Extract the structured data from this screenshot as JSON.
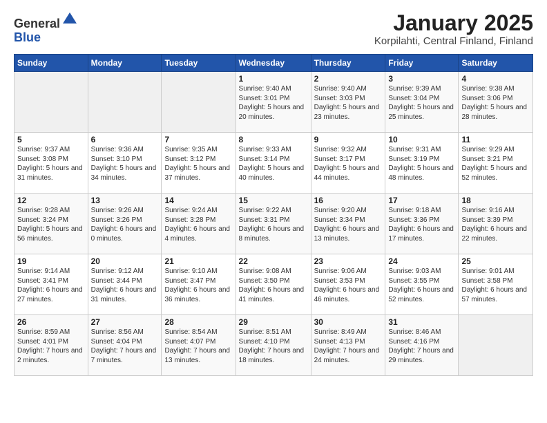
{
  "header": {
    "logo_line1": "General",
    "logo_line2": "Blue",
    "title": "January 2025",
    "subtitle": "Korpilahti, Central Finland, Finland"
  },
  "weekdays": [
    "Sunday",
    "Monday",
    "Tuesday",
    "Wednesday",
    "Thursday",
    "Friday",
    "Saturday"
  ],
  "weeks": [
    [
      {
        "day": "",
        "info": ""
      },
      {
        "day": "",
        "info": ""
      },
      {
        "day": "",
        "info": ""
      },
      {
        "day": "1",
        "info": "Sunrise: 9:40 AM\nSunset: 3:01 PM\nDaylight: 5 hours\nand 20 minutes."
      },
      {
        "day": "2",
        "info": "Sunrise: 9:40 AM\nSunset: 3:03 PM\nDaylight: 5 hours\nand 23 minutes."
      },
      {
        "day": "3",
        "info": "Sunrise: 9:39 AM\nSunset: 3:04 PM\nDaylight: 5 hours\nand 25 minutes."
      },
      {
        "day": "4",
        "info": "Sunrise: 9:38 AM\nSunset: 3:06 PM\nDaylight: 5 hours\nand 28 minutes."
      }
    ],
    [
      {
        "day": "5",
        "info": "Sunrise: 9:37 AM\nSunset: 3:08 PM\nDaylight: 5 hours\nand 31 minutes."
      },
      {
        "day": "6",
        "info": "Sunrise: 9:36 AM\nSunset: 3:10 PM\nDaylight: 5 hours\nand 34 minutes."
      },
      {
        "day": "7",
        "info": "Sunrise: 9:35 AM\nSunset: 3:12 PM\nDaylight: 5 hours\nand 37 minutes."
      },
      {
        "day": "8",
        "info": "Sunrise: 9:33 AM\nSunset: 3:14 PM\nDaylight: 5 hours\nand 40 minutes."
      },
      {
        "day": "9",
        "info": "Sunrise: 9:32 AM\nSunset: 3:17 PM\nDaylight: 5 hours\nand 44 minutes."
      },
      {
        "day": "10",
        "info": "Sunrise: 9:31 AM\nSunset: 3:19 PM\nDaylight: 5 hours\nand 48 minutes."
      },
      {
        "day": "11",
        "info": "Sunrise: 9:29 AM\nSunset: 3:21 PM\nDaylight: 5 hours\nand 52 minutes."
      }
    ],
    [
      {
        "day": "12",
        "info": "Sunrise: 9:28 AM\nSunset: 3:24 PM\nDaylight: 5 hours\nand 56 minutes."
      },
      {
        "day": "13",
        "info": "Sunrise: 9:26 AM\nSunset: 3:26 PM\nDaylight: 6 hours\nand 0 minutes."
      },
      {
        "day": "14",
        "info": "Sunrise: 9:24 AM\nSunset: 3:28 PM\nDaylight: 6 hours\nand 4 minutes."
      },
      {
        "day": "15",
        "info": "Sunrise: 9:22 AM\nSunset: 3:31 PM\nDaylight: 6 hours\nand 8 minutes."
      },
      {
        "day": "16",
        "info": "Sunrise: 9:20 AM\nSunset: 3:34 PM\nDaylight: 6 hours\nand 13 minutes."
      },
      {
        "day": "17",
        "info": "Sunrise: 9:18 AM\nSunset: 3:36 PM\nDaylight: 6 hours\nand 17 minutes."
      },
      {
        "day": "18",
        "info": "Sunrise: 9:16 AM\nSunset: 3:39 PM\nDaylight: 6 hours\nand 22 minutes."
      }
    ],
    [
      {
        "day": "19",
        "info": "Sunrise: 9:14 AM\nSunset: 3:41 PM\nDaylight: 6 hours\nand 27 minutes."
      },
      {
        "day": "20",
        "info": "Sunrise: 9:12 AM\nSunset: 3:44 PM\nDaylight: 6 hours\nand 31 minutes."
      },
      {
        "day": "21",
        "info": "Sunrise: 9:10 AM\nSunset: 3:47 PM\nDaylight: 6 hours\nand 36 minutes."
      },
      {
        "day": "22",
        "info": "Sunrise: 9:08 AM\nSunset: 3:50 PM\nDaylight: 6 hours\nand 41 minutes."
      },
      {
        "day": "23",
        "info": "Sunrise: 9:06 AM\nSunset: 3:53 PM\nDaylight: 6 hours\nand 46 minutes."
      },
      {
        "day": "24",
        "info": "Sunrise: 9:03 AM\nSunset: 3:55 PM\nDaylight: 6 hours\nand 52 minutes."
      },
      {
        "day": "25",
        "info": "Sunrise: 9:01 AM\nSunset: 3:58 PM\nDaylight: 6 hours\nand 57 minutes."
      }
    ],
    [
      {
        "day": "26",
        "info": "Sunrise: 8:59 AM\nSunset: 4:01 PM\nDaylight: 7 hours\nand 2 minutes."
      },
      {
        "day": "27",
        "info": "Sunrise: 8:56 AM\nSunset: 4:04 PM\nDaylight: 7 hours\nand 7 minutes."
      },
      {
        "day": "28",
        "info": "Sunrise: 8:54 AM\nSunset: 4:07 PM\nDaylight: 7 hours\nand 13 minutes."
      },
      {
        "day": "29",
        "info": "Sunrise: 8:51 AM\nSunset: 4:10 PM\nDaylight: 7 hours\nand 18 minutes."
      },
      {
        "day": "30",
        "info": "Sunrise: 8:49 AM\nSunset: 4:13 PM\nDaylight: 7 hours\nand 24 minutes."
      },
      {
        "day": "31",
        "info": "Sunrise: 8:46 AM\nSunset: 4:16 PM\nDaylight: 7 hours\nand 29 minutes."
      },
      {
        "day": "",
        "info": ""
      }
    ]
  ]
}
